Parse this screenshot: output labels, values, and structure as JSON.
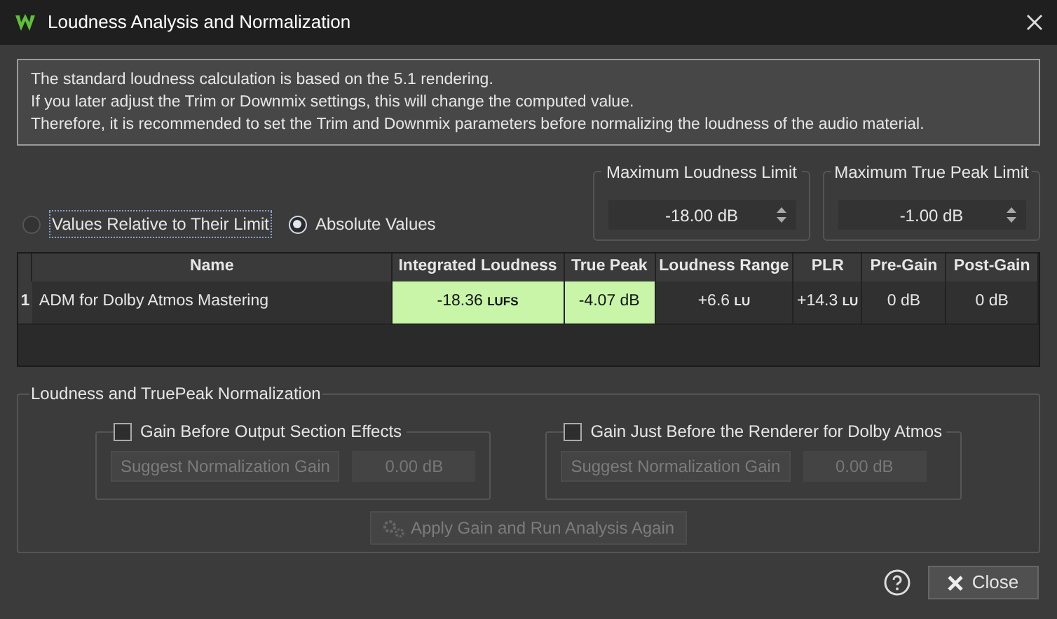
{
  "window": {
    "title": "Loudness Analysis and Normalization"
  },
  "info_lines": [
    "The standard loudness calculation is based on the 5.1 rendering.",
    "If you later adjust the Trim or Downmix settings, this will change the computed value.",
    "Therefore, it is recommended to set the Trim and Downmix parameters before normalizing the loudness of the audio material."
  ],
  "display_mode": [
    {
      "label": "Values Relative to Their Limit",
      "selected": false
    },
    {
      "label": "Absolute Values",
      "selected": true
    }
  ],
  "limits": [
    {
      "label": "Maximum Loudness Limit",
      "value": "-18.00 dB"
    },
    {
      "label": "Maximum True Peak Limit",
      "value": "-1.00 dB"
    }
  ],
  "table": {
    "columns": [
      "Name",
      "Integrated Loudness",
      "True Peak",
      "Loudness Range",
      "PLR",
      "Pre-Gain",
      "Post-Gain"
    ],
    "rows": [
      {
        "index": "1",
        "cells": [
          {
            "value": "ADM for Dolby Atmos Mastering",
            "highlighted": false
          },
          {
            "value": "-18.36",
            "unit": "LUFS",
            "highlighted": true
          },
          {
            "value": "-4.07 dB",
            "highlighted": true
          },
          {
            "value": "+6.6",
            "unit": "LU",
            "highlighted": false
          },
          {
            "value": "+14.3",
            "unit": "LU",
            "highlighted": false
          },
          {
            "value": "0 dB",
            "highlighted": false
          },
          {
            "value": "0 dB",
            "highlighted": false
          }
        ]
      }
    ]
  },
  "normalization": {
    "title": "Loudness and TruePeak Normalization",
    "groups": [
      {
        "label": "Gain Before Output Section Effects",
        "checked": false,
        "button": "Suggest Normalization Gain",
        "value": "0.00 dB",
        "disabled": true
      },
      {
        "label": "Gain Just Before the Renderer for Dolby Atmos",
        "checked": false,
        "button": "Suggest Normalization Gain",
        "value": "0.00 dB",
        "disabled": true
      }
    ],
    "apply": {
      "label": "Apply Gain and Run Analysis Again",
      "disabled": true
    }
  },
  "buttons": [
    {
      "label": "Close"
    }
  ]
}
